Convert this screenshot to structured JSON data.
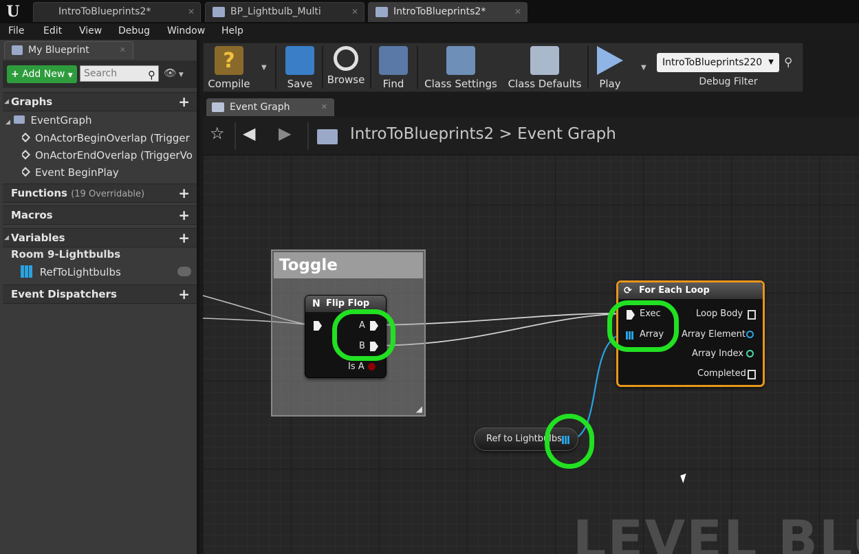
{
  "tabs": [
    {
      "label": "IntroToBlueprints2*"
    },
    {
      "label": "BP_Lightbulb_Multi"
    },
    {
      "label": "IntroToBlueprints2*"
    }
  ],
  "menu": [
    "File",
    "Edit",
    "View",
    "Debug",
    "Window",
    "Help"
  ],
  "my_blueprint": {
    "tab_label": "My Blueprint",
    "add_new": "Add New",
    "search_placeholder": "Search",
    "graphs": {
      "label": "Graphs",
      "event_graph": "EventGraph",
      "events": [
        "OnActorBeginOverlap (Trigger",
        "OnActorEndOverlap (TriggerVo",
        "Event BeginPlay"
      ]
    },
    "functions": {
      "label": "Functions",
      "sub": "(19 Overridable)"
    },
    "macros": {
      "label": "Macros"
    },
    "variables": {
      "label": "Variables",
      "category": "Room 9-Lightbulbs",
      "var": "RefToLightbulbs"
    },
    "dispatchers": {
      "label": "Event Dispatchers"
    }
  },
  "toolbar": {
    "compile": "Compile",
    "save": "Save",
    "browse": "Browse",
    "find": "Find",
    "class_settings": "Class Settings",
    "class_defaults": "Class Defaults",
    "play": "Play",
    "debug_value": "IntroToBlueprints220",
    "debug_label": "Debug Filter"
  },
  "graph_tab": "Event Graph",
  "breadcrumb": {
    "root": "IntroToBlueprints2",
    "sep": ">",
    "current": "Event Graph"
  },
  "graph": {
    "comment": "Toggle",
    "flipflop": {
      "title": "Flip Flop",
      "a": "A",
      "b": "B",
      "is_a": "Is A"
    },
    "foreach": {
      "title": "For Each Loop",
      "exec": "Exec",
      "array": "Array",
      "loop_body": "Loop Body",
      "array_element": "Array Element",
      "array_index": "Array Index",
      "completed": "Completed"
    },
    "ref_node": "Ref to Lightbulbs",
    "watermark": "LEVEL BLUEP"
  },
  "colors": {
    "highlight": "#22e022",
    "array_pin": "#29a3e0",
    "index_pin": "#4bd7a8",
    "bool_pin": "#8b0000",
    "foreach_border": "#e8961c"
  }
}
